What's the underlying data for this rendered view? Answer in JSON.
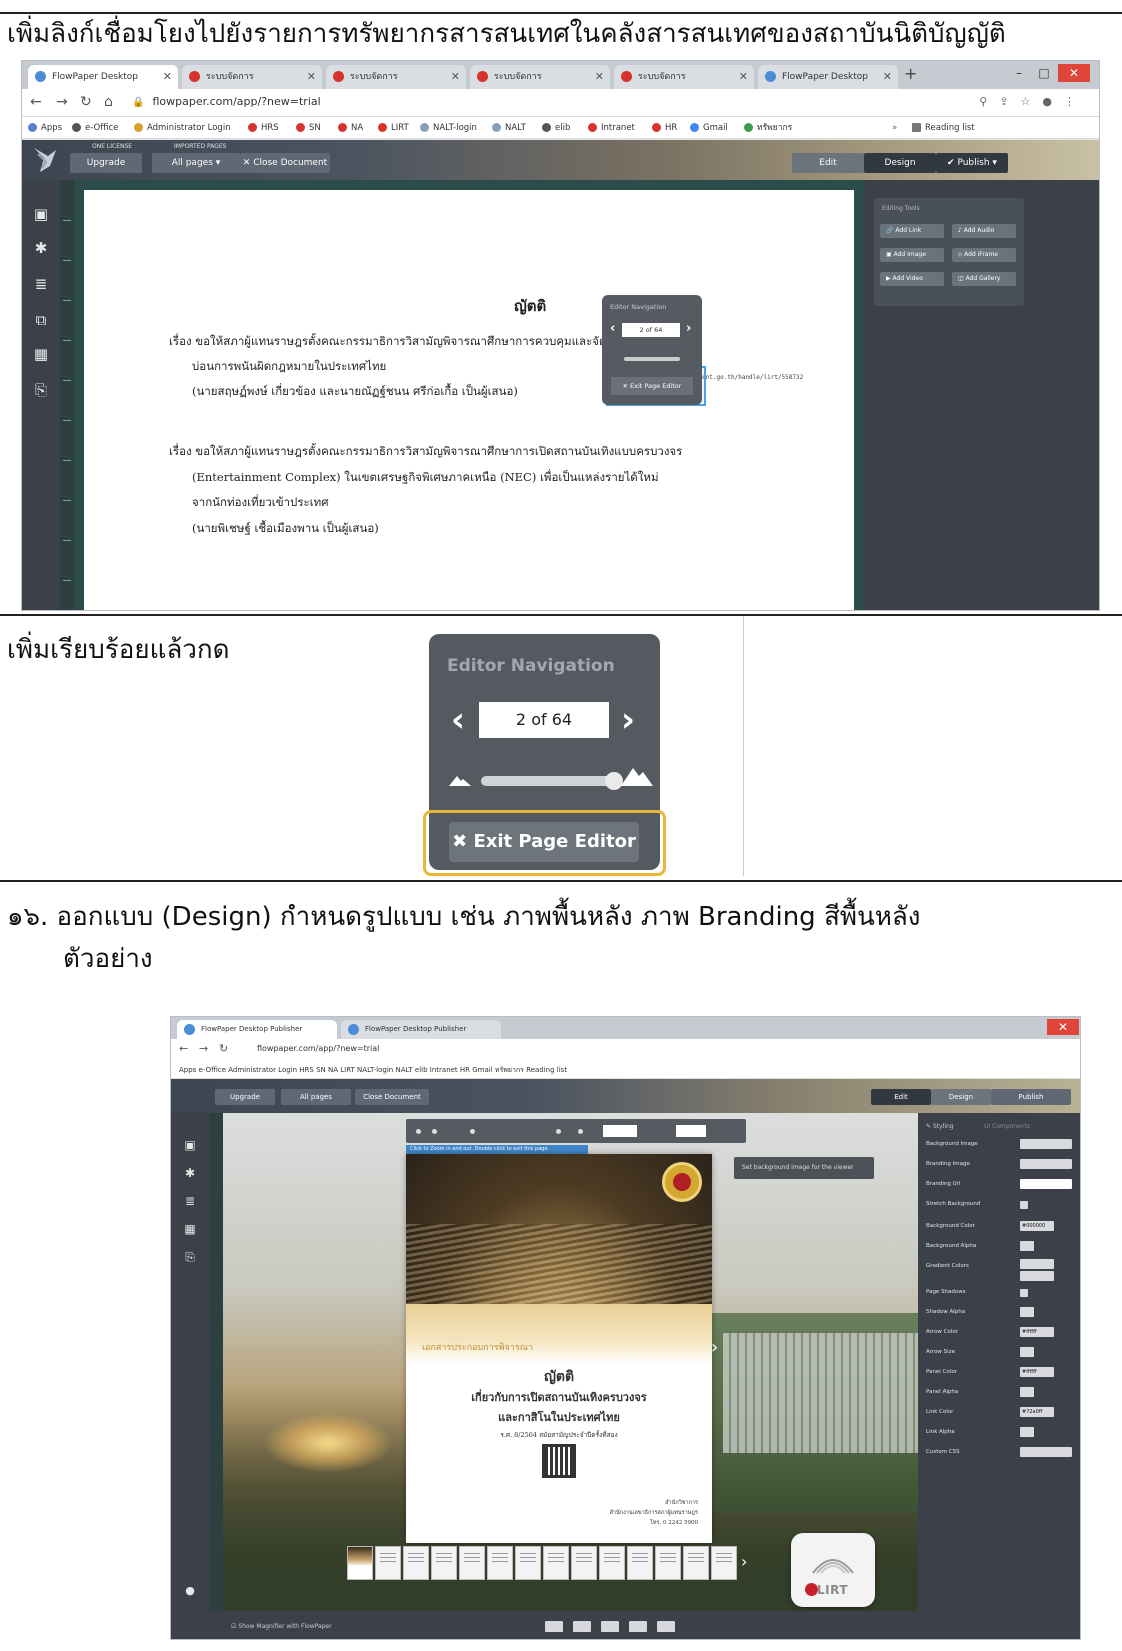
{
  "sections": {
    "s1_title": "เพิ่มลิงก์เชื่อมโยงไปยังรายการทรัพยากรสารสนเทศในคลังสารสนเทศของสถาบันนิติบัญญัติ",
    "s2_text": "เพิ่มเรียบร้อยแล้วกด",
    "s3_heading": "๑๖. ออกแบบ (Design) กำหนดรูปแบบ เช่น ภาพพื้นหลัง ภาพ Branding สีพื้นหลัง",
    "s3_sub": "ตัวอย่าง"
  },
  "browser1": {
    "tabs": [
      "FlowPaper Desktop",
      "ระบบจัดการ",
      "ระบบจัดการ",
      "ระบบจัดการ",
      "ระบบจัดการ",
      "FlowPaper Desktop"
    ],
    "url": "flowpaper.com/app/?new=trial",
    "bookmarks": [
      "Apps",
      "e-Office",
      "Administrator Login",
      "HRS",
      "SN",
      "NA",
      "LIRT",
      "NALT-login",
      "NALT",
      "elib",
      "Intranet",
      "HR",
      "Gmail",
      "ทรัพยากร",
      "Reading list"
    ],
    "toolbar": {
      "upgrade": "Upgrade",
      "all_pages": "All pages",
      "close_doc": "Close Document",
      "edit": "Edit",
      "design": "Design",
      "publish": "Publish",
      "one_license": "ONE LICENSE",
      "imported_pages": "IMPORTED PAGES"
    },
    "page": {
      "title": "ญัตติ",
      "lines": [
        "เรื่อง ขอให้สภาผู้แทนราษฎรตั้งคณะกรรมาธิการวิสามัญพิจารณาศึกษาการควบคุมและจัดระเบียบ",
        "บ่อนการพนันผิดกฎหมายในประเทศไทย",
        "(นายสฤษฏ์พงษ์ เกี่ยวข้อง และนายณัฏฐ์ชนน ศรีก่อเกื้อ เป็นผู้เสนอ)",
        "เรื่อง ขอให้สภาผู้แทนราษฎรตั้งคณะกรรมาธิการวิสามัญพิจารณาศึกษาการเปิดสถานบันเทิงแบบครบวงจร",
        "(Entertainment Complex) ในเขตเศรษฐกิจพิเศษภาคเหนือ (NEC) เพื่อเป็นแหล่งรายได้ใหม่",
        "จากนักท่องเที่ยวเข้าประเทศ",
        "(นายพิเชษฐ์ เชื้อเมืองพาน เป็นผู้เสนอ)"
      ],
      "link_url": "URL: https://dl.parliament.go.th/handle/lirt/558732"
    },
    "mini_nav": {
      "title": "Editor Navigation",
      "page": "2 of 64",
      "exit": "Exit Page Editor"
    },
    "tools": {
      "title": "Editing Tools",
      "items": [
        "Add Link",
        "Add Audio",
        "Add Image",
        "Add iFrame",
        "Add Video",
        "Add Gallery"
      ]
    }
  },
  "zoom_nav": {
    "title": "Editor Navigation",
    "page": "2 of 64",
    "exit": "Exit Page Editor"
  },
  "browser2": {
    "tabs": [
      "FlowPaper Desktop Publisher",
      "FlowPaper Desktop Publisher"
    ],
    "url": "flowpaper.com/app/?new=trial",
    "bookmarks": "Apps   e-Office   Administrator Login   HRS   SN   NA   LIRT   NALT-login   NALT   elib   Intranet   HR   Gmail   ทรัพยากร   Reading list",
    "hint": "Click to Zoom in and out. Double click to exit this page.",
    "tip": "Set background image for the viewer",
    "book": {
      "kicker": "เอกสารประกอบการพิจารณา",
      "title": "ญัตติ",
      "line1": "เกี่ยวกับการเปิดสถานบันเทิงครบวงจร",
      "line2": "และกาสิโนในประเทศไทย",
      "small": "ร.ศ. 8/2564  สมัยสามัญประจำปีครั้งที่สอง",
      "foot1": "สำนักวิชาการ",
      "foot2": "สำนักงานเลขาธิการสภาผู้แทนราษฎร",
      "foot3": "โทร. 0 2242 5900"
    },
    "lirt": "LIRT",
    "settings": {
      "tab1": "Styling",
      "tab2": "UI Components",
      "rows": [
        "Background Image",
        "Branding Image",
        "Branding Url",
        "Stretch Background",
        "Background Color",
        "Background Alpha",
        "Gradient Colors",
        "Page Shadows",
        "Shadow Alpha",
        "Arrow Color",
        "Arrow Size",
        "Panel Color",
        "Panel Alpha",
        "Link Color",
        "Link Alpha",
        "Custom CSS"
      ],
      "bg_color": "#000000",
      "arrow_color": "#ffffff",
      "panel_color": "#ffffff",
      "link_color": "#72a0ff"
    },
    "bottom_check": "Show Magnifier with FlowPaper"
  }
}
